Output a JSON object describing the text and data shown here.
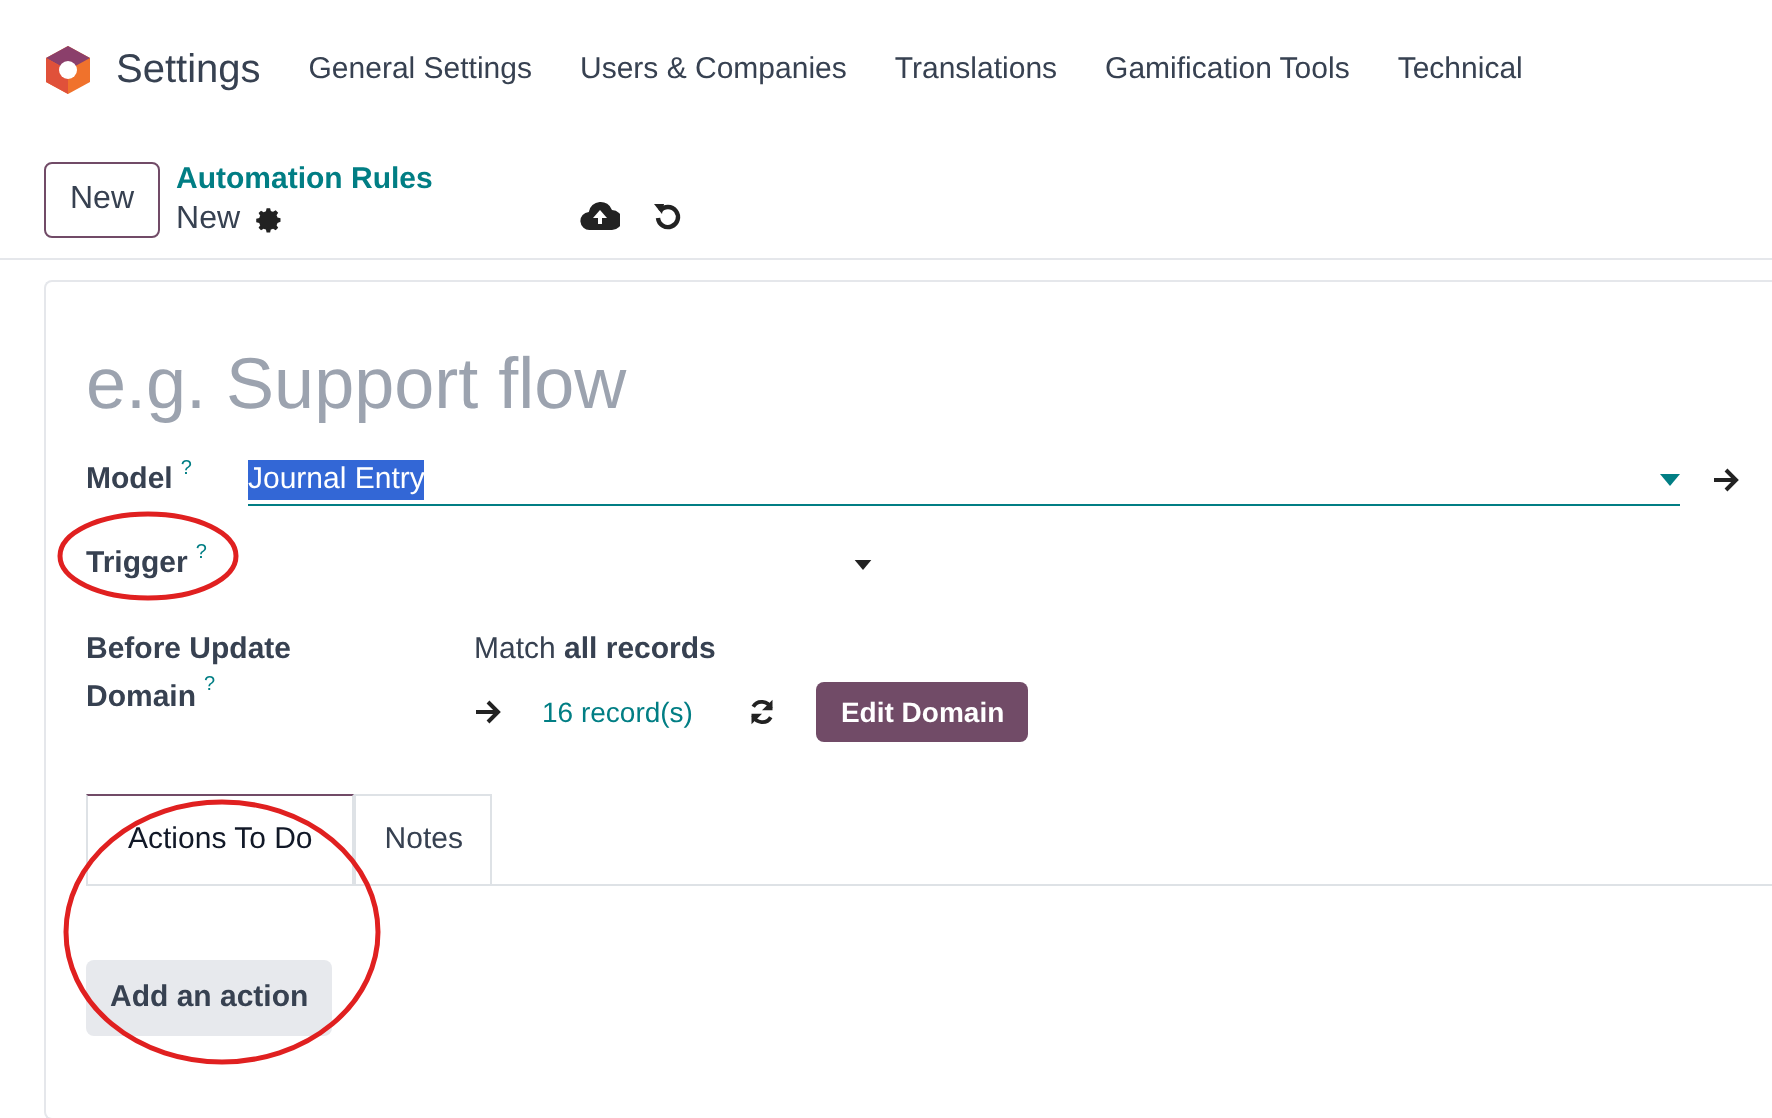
{
  "navbar": {
    "app_name": "Settings",
    "menu": [
      "General Settings",
      "Users & Companies",
      "Translations",
      "Gamification Tools",
      "Technical"
    ]
  },
  "control_panel": {
    "new_button": "New",
    "breadcrumb": "Automation Rules",
    "record": "New"
  },
  "form": {
    "name_placeholder": "e.g. Support flow",
    "model": {
      "label": "Model",
      "help": "?",
      "value": "Journal Entry"
    },
    "trigger": {
      "label": "Trigger",
      "help": "?"
    },
    "domain": {
      "label_line1": "Before Update",
      "label_line2": "Domain",
      "help": "?",
      "match": "Match **all records**",
      "records": "16 record(s)",
      "edit_button": "Edit Domain"
    },
    "tabs": [
      {
        "label": "Actions To Do",
        "selected": true
      },
      {
        "label": "Notes",
        "selected": false
      }
    ],
    "add_action": "Add an action"
  }
}
